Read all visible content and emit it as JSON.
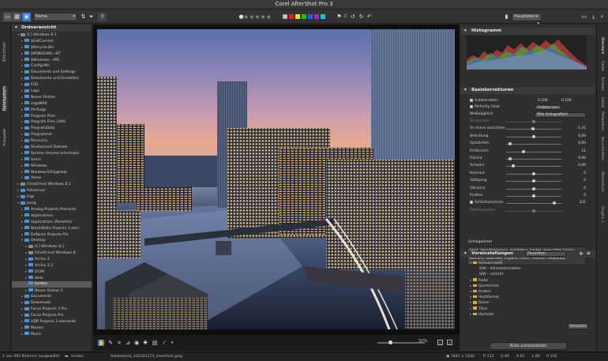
{
  "window": {
    "title": "Corel AfterShot Pro 3"
  },
  "toolbar": {
    "sort_value": "Name",
    "stars": "★★★★★",
    "color_labels": [
      "#e02020",
      "#f0e020",
      "#20c020",
      "#2060e0",
      "#a030c0",
      "#20c0d0"
    ],
    "color_label_none": "#cccccc",
    "workspace_value": "Hauptebene"
  },
  "left_tabs": [
    "Bibliothek",
    "Dateisystem",
    "Ausgabe"
  ],
  "folder_panel": {
    "title": "Ordneransicht",
    "items": [
      {
        "label": "[C] Windows 8.1",
        "indent": 1,
        "exp": "▾"
      },
      {
        "label": "$GetCurrent",
        "indent": 2,
        "exp": "▸"
      },
      {
        "label": "$Recycle.Bin",
        "indent": 2,
        "exp": "▸"
      },
      {
        "label": "$WINDOWS.~BT",
        "indent": 2,
        "exp": "▸"
      },
      {
        "label": "$Windows.~WS",
        "indent": 2,
        "exp": "▸"
      },
      {
        "label": "Config.Msi",
        "indent": 2,
        "exp": "▸"
      },
      {
        "label": "Documents and Settings",
        "indent": 2,
        "exp": "▸"
      },
      {
        "label": "Dokumente und Einstellun",
        "indent": 2,
        "exp": "▸"
      },
      {
        "label": "ESD",
        "indent": 2,
        "exp": "▸"
      },
      {
        "label": "Logs",
        "indent": 2,
        "exp": "▸"
      },
      {
        "label": "Neuer Ordner",
        "indent": 2,
        "exp": "▸"
      },
      {
        "label": "orgaMAX",
        "indent": 2,
        "exp": "▸"
      },
      {
        "label": "PerfLogs",
        "indent": 2,
        "exp": "▸"
      },
      {
        "label": "Program Files",
        "indent": 2,
        "exp": "▸"
      },
      {
        "label": "Program Files (x86)",
        "indent": 2,
        "exp": "▸"
      },
      {
        "label": "ProgramData",
        "indent": 2,
        "exp": "▸"
      },
      {
        "label": "Programme",
        "indent": 2,
        "exp": "▸"
      },
      {
        "label": "Recovery",
        "indent": 2,
        "exp": "▸"
      },
      {
        "label": "StudioLine4 Dateien",
        "indent": 2,
        "exp": "▸"
      },
      {
        "label": "System Volume Informatio",
        "indent": 2,
        "exp": "▸"
      },
      {
        "label": "Users",
        "indent": 2,
        "exp": "▸"
      },
      {
        "label": "Windows",
        "indent": 2,
        "exp": "▸"
      },
      {
        "label": "Windows10Upgrade",
        "indent": 2,
        "exp": "▸"
      },
      {
        "label": "Xerox",
        "indent": 2,
        "exp": "▸"
      },
      {
        "label": "[OneDrive] Windows 8.1",
        "indent": 1,
        "exp": "▸"
      },
      {
        "label": "fotoserver",
        "indent": 1,
        "exp": "▸"
      },
      {
        "label": "H@l",
        "indent": 1,
        "exp": "▸"
      },
      {
        "label": "joerg",
        "indent": 1,
        "exp": "▾"
      },
      {
        "label": "Analog Projects Premium",
        "indent": 2,
        "exp": "▸"
      },
      {
        "label": "Applications",
        "indent": 2,
        "exp": "▸"
      },
      {
        "label": "Applications (Parallels)",
        "indent": 2,
        "exp": "▸"
      },
      {
        "label": "BlackWhite Projects 3 elen",
        "indent": 2,
        "exp": "▸"
      },
      {
        "label": "DeNoise Projects Pro",
        "indent": 2,
        "exp": "▸"
      },
      {
        "label": "Desktop",
        "indent": 2,
        "exp": "▾"
      },
      {
        "label": "[C] Windows 8.1",
        "indent": 3,
        "exp": "▸"
      },
      {
        "label": "[OneDrive] Windows 8.",
        "indent": 3,
        "exp": "▸"
      },
      {
        "label": "Archiv 2",
        "indent": 3,
        "exp": "▸"
      },
      {
        "label": "Archiv 2 2",
        "indent": 3,
        "exp": "▸"
      },
      {
        "label": "DCIM",
        "indent": 3,
        "exp": "▸"
      },
      {
        "label": "desk",
        "indent": 3,
        "exp": "▸"
      },
      {
        "label": "london",
        "indent": 3,
        "exp": "",
        "selected": true
      },
      {
        "label": "Neuer Ordner 2",
        "indent": 3,
        "exp": "▸"
      },
      {
        "label": "Documents",
        "indent": 2,
        "exp": "▸"
      },
      {
        "label": "Downloads",
        "indent": 2,
        "exp": "▸"
      },
      {
        "label": "Focus Projects 3 Pro",
        "indent": 2,
        "exp": "▸"
      },
      {
        "label": "Focus Projects Pro",
        "indent": 2,
        "exp": "▸"
      },
      {
        "label": "HDR Projects 3 elements",
        "indent": 2,
        "exp": "▸"
      },
      {
        "label": "Movies",
        "indent": 2,
        "exp": "▸"
      },
      {
        "label": "Music",
        "indent": 2,
        "exp": "▸"
      }
    ]
  },
  "edit_toolbar": {
    "zoom_label": "32%"
  },
  "right_panel": {
    "histogram_title": "Histogramm",
    "basis_title": "Basiskorrekturen",
    "auto_label": "Autokorrektur",
    "auto_vals": [
      "0,100",
      "0,100"
    ],
    "perfectly_clear_label": "Perfectly Clear",
    "perfectly_clear_btn": "Farbton aus",
    "wb_label": "Weißabgleich",
    "wb_value": "Wie fotografiert",
    "rows": [
      {
        "label": "Temperatur",
        "value": "",
        "pos": 0.5,
        "dim": true
      },
      {
        "label": "An Achse ausrichten",
        "value": "-1,41",
        "pos": 0.48
      },
      {
        "label": "Belichtung",
        "value": "0,00",
        "pos": 0.5
      },
      {
        "label": "Spitzlichter",
        "value": "0,00",
        "pos": 0.05
      },
      {
        "label": "Fill-Bereich",
        "value": "21",
        "pos": 0.3
      },
      {
        "label": "Füllicht",
        "value": "0,00",
        "pos": 0.05
      },
      {
        "label": "Schwarz",
        "value": "0,00",
        "pos": 0.1
      },
      {
        "label": "Kontrast",
        "value": "0",
        "pos": 0.5
      },
      {
        "label": "Sättigung",
        "value": "0",
        "pos": 0.5
      },
      {
        "label": "Vibrance",
        "value": "0",
        "pos": 0.5
      },
      {
        "label": "Farbton",
        "value": "0",
        "pos": 0.5
      },
      {
        "label": "Schärfezeichnen",
        "value": "331",
        "pos": 0.9,
        "check": true
      },
      {
        "label": "RAW-Rauschen",
        "value": "",
        "pos": 0.5,
        "dim": true
      }
    ],
    "keywords_title": "Schlagwörter",
    "keywords_text": "aland, abendämmerung, architektur, banken, beleuchtet, brücke, bürogebäude, bros, business, canary wharf, city, dämmerung, dockland, downtown, england, finanz, finanzen, hauptstadt,",
    "presets_title": "Voreinstellungen",
    "presets_dropdown": "Favoriten",
    "presets": [
      {
        "label": "Schwarz-weiß",
        "indent": 0,
        "folder": true
      },
      {
        "label": "S/W – Infrarotsimulation",
        "indent": 1,
        "folder": false
      },
      {
        "label": "S/W – schlicht",
        "indent": 1,
        "folder": false
      },
      {
        "label": "Farbe",
        "indent": 0,
        "folder": true
      },
      {
        "label": "Querformat",
        "indent": 0,
        "folder": true
      },
      {
        "label": "Andere",
        "indent": 0,
        "folder": true
      },
      {
        "label": "Hochformat",
        "indent": 0,
        "folder": true
      },
      {
        "label": "Szene",
        "indent": 0,
        "folder": true
      },
      {
        "label": "Tiere",
        "indent": 0,
        "folder": true
      },
      {
        "label": "Hochzeit",
        "indent": 0,
        "folder": true
      }
    ],
    "manage_btn": "Verwalten",
    "reset_all_btn": "Alles zurücksetzen"
  },
  "right_tabs": [
    "Standard",
    "Farbe",
    "Tonwert",
    "Detail",
    "Metadaten",
    "Neuschnitten",
    "Wellenform",
    "Plugins 1"
  ],
  "status": {
    "selection": "1 von 492 Bild(ern) ausgewählt",
    "folder": "london",
    "filename": "Adobestock_142341173_meerfuds.jpeg",
    "dims": "▣ 3841 × 1544",
    "r": "R 112",
    "g": "G 86",
    "b": "B 61",
    "l": "L 86",
    "h": "H 102"
  }
}
